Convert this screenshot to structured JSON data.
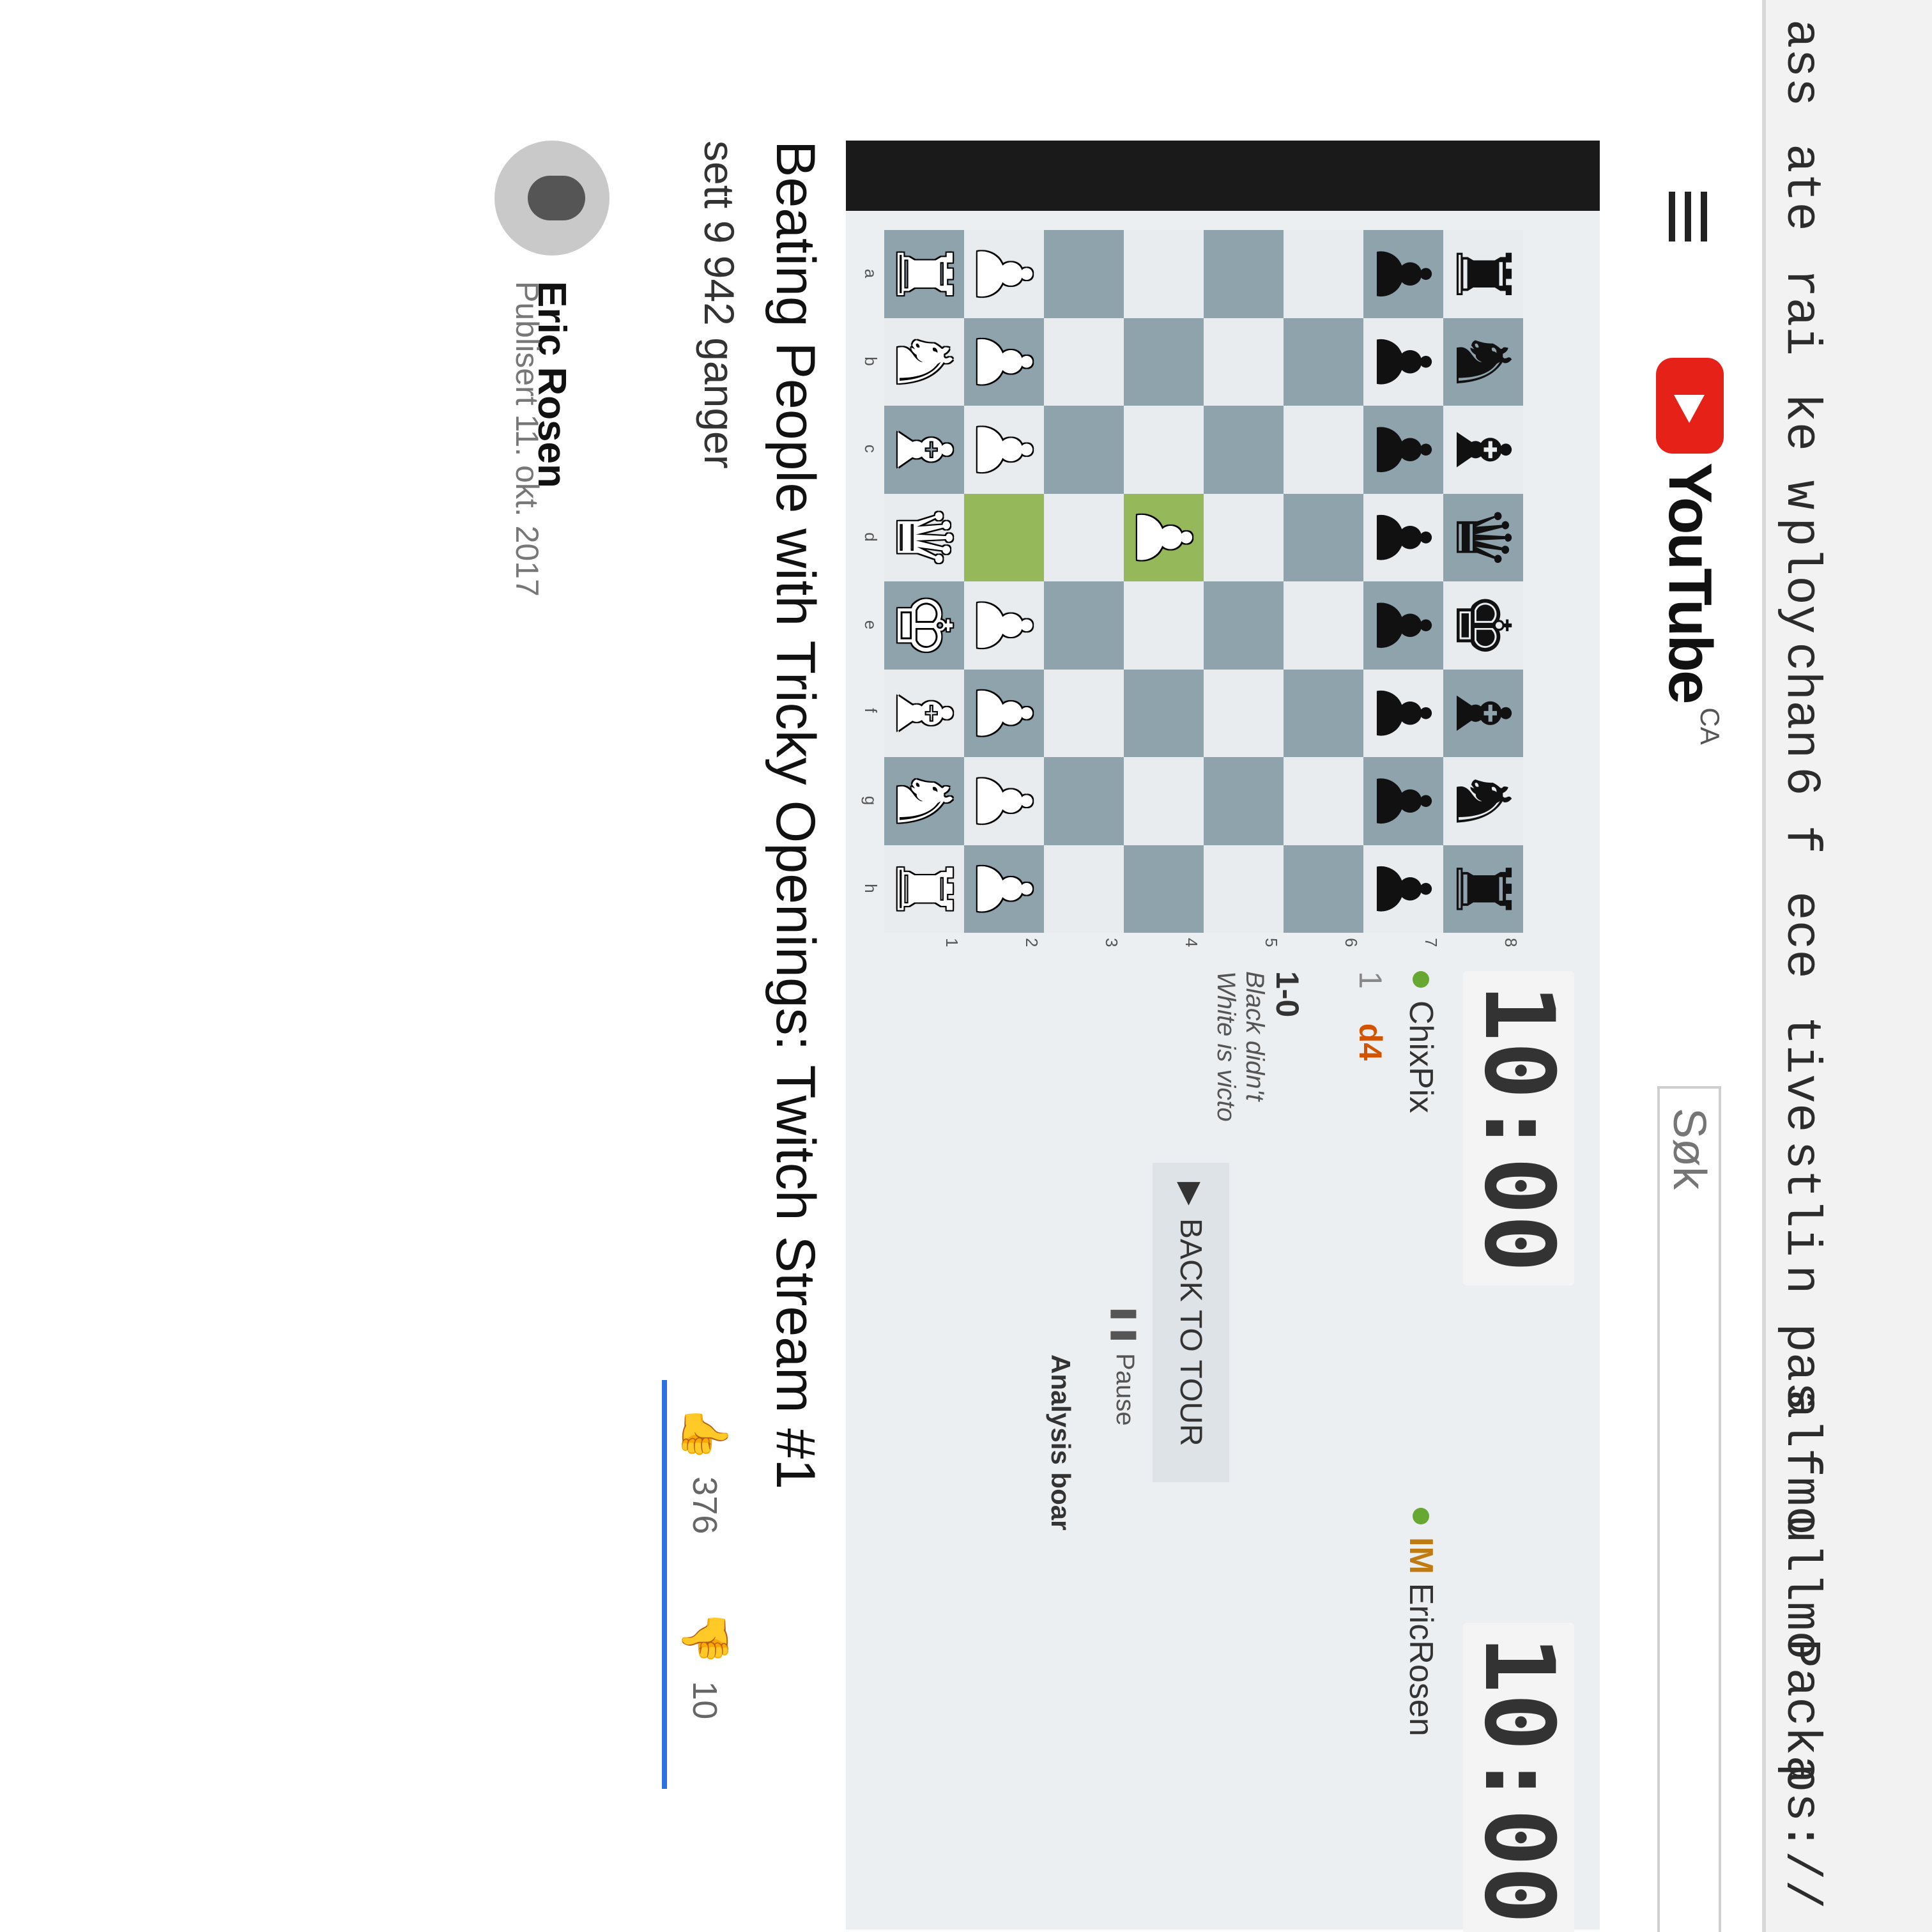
{
  "code_strip": {
    "lines": [
      "ass",
      "ate",
      "rai",
      "ke w",
      "ploy",
      "chan",
      "6 f",
      "ece",
      "tive",
      "stli",
      "n pas",
      "alfmo",
      "ullmo",
      "Packa",
      "ps://"
    ]
  },
  "masthead": {
    "logo_text": "YouTube",
    "country_code": "CA",
    "search_placeholder": "Søk"
  },
  "board": {
    "files": [
      "a",
      "b",
      "c",
      "d",
      "e",
      "f",
      "g",
      "h"
    ],
    "ranks": [
      "8",
      "7",
      "6",
      "5",
      "4",
      "3",
      "2",
      "1"
    ],
    "position": [
      [
        "r",
        "n",
        "b",
        "q",
        "k",
        "b",
        "n",
        "r"
      ],
      [
        "p",
        "p",
        "p",
        "p",
        "p",
        "p",
        "p",
        "p"
      ],
      [
        "",
        "",
        "",
        "",
        "",
        "",
        "",
        ""
      ],
      [
        "",
        "",
        "",
        "",
        "",
        "",
        "",
        ""
      ],
      [
        "",
        "",
        "",
        "P",
        "",
        "",
        "",
        ""
      ],
      [
        "",
        "",
        "",
        "",
        "",
        "",
        "",
        ""
      ],
      [
        "P",
        "P",
        "P",
        "",
        "P",
        "P",
        "P",
        "P"
      ],
      [
        "R",
        "N",
        "B",
        "Q",
        "K",
        "B",
        "N",
        "R"
      ]
    ],
    "last_move_squares": [
      "d2",
      "d4"
    ]
  },
  "side_panel": {
    "clock_top": "10:00",
    "clock_bottom": "10:00",
    "player_top": "ChixPix",
    "player_bottom_title": "IM",
    "player_bottom": "EricRosen",
    "move_number": "1",
    "move_san": "d4",
    "result_score": "1-0",
    "result_line1": "Black didn't",
    "result_line2": "White is victo",
    "back_button": "BACK TO TOUR",
    "pause_label": "Pause",
    "analysis_label": "Analysis boar"
  },
  "video": {
    "title": "Beating People with Tricky Openings: Twitch Stream #1",
    "views": "sett 9 942 ganger",
    "likes": "376",
    "dislikes": "10",
    "channel": "Eric Rosen",
    "published": "Publisert 11. okt. 2017"
  },
  "colors": {
    "youtube_red": "#e62117",
    "board_light": "#e8ecee",
    "board_dark": "#8fa3ad",
    "highlight": "#95b85a",
    "rating_blue": "#2a72e0"
  }
}
